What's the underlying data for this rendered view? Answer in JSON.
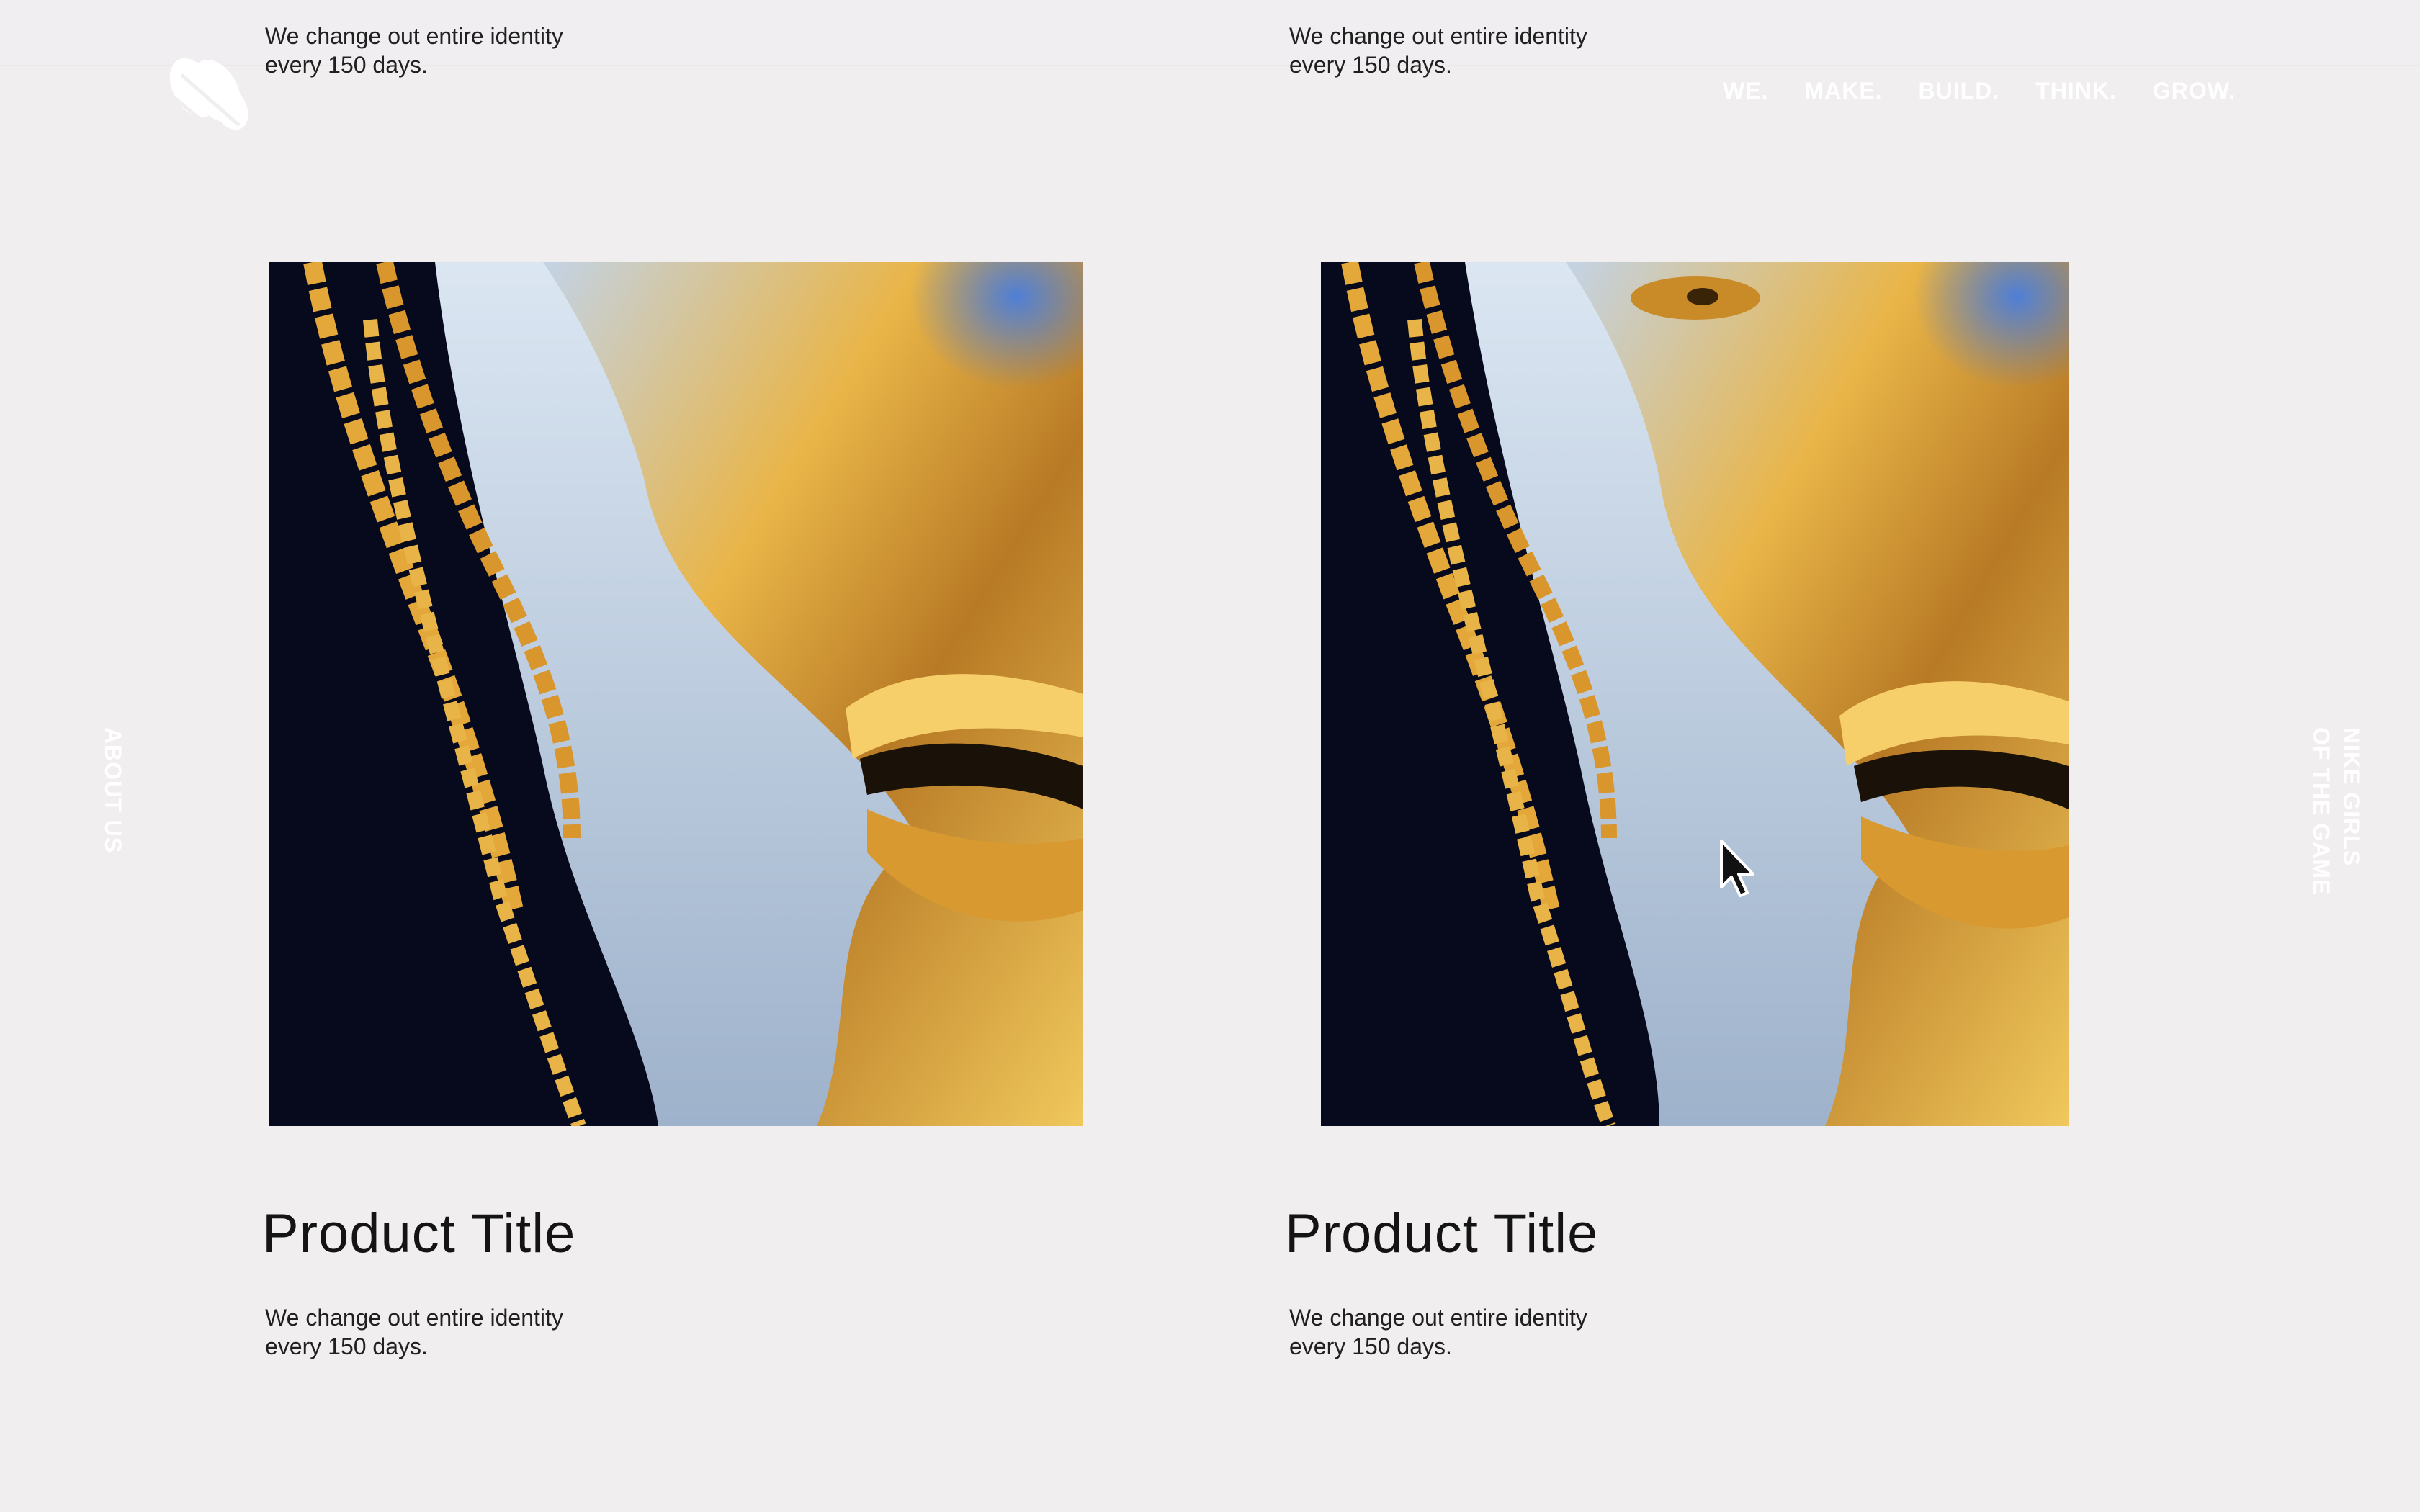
{
  "header": {
    "nav": [
      {
        "label": "WE."
      },
      {
        "label": "MAKE."
      },
      {
        "label": "BUILD."
      },
      {
        "label": "THINK."
      },
      {
        "label": "GROW."
      }
    ]
  },
  "side_labels": {
    "left": "ABOUT US",
    "right": "NIKE GIRLS\nOF THE GAME"
  },
  "top_descriptions": [
    {
      "text": "We change out entire identity\nevery 150 days."
    },
    {
      "text": "We change out entire identity\nevery 150 days."
    }
  ],
  "products": [
    {
      "title": "Product Title",
      "description": "We change out entire identity\nevery 150 days.",
      "image": "chrome-gold-sculpture-face"
    },
    {
      "title": "Product Title",
      "description": "We change out entire identity\nevery 150 days.",
      "image": "chrome-gold-sculpture-face"
    }
  ],
  "colors": {
    "background": "#f1eeef",
    "image_bg": "#07091c",
    "gold": "#e2a52c",
    "chrome": "#b9c9dc",
    "nav_text": "#ffffff"
  },
  "icons": [
    "logo-mark",
    "mouse-cursor"
  ]
}
